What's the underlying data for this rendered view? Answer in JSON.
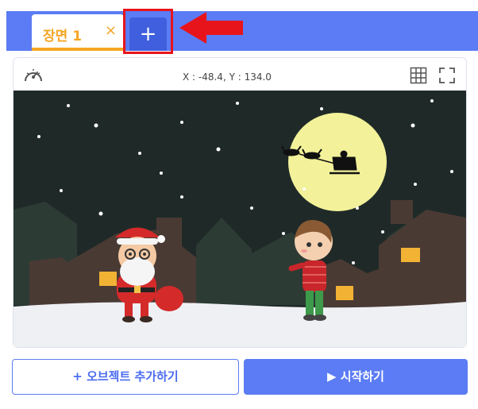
{
  "tabs": {
    "scene_tab_label": "장면 1",
    "close_glyph": "×",
    "add_scene_glyph": "+"
  },
  "toolbar": {
    "coordinates": "X : -48.4, Y : 134.0",
    "speed_icon": "gauge-icon",
    "grid_icon": "grid-icon",
    "fullscreen_icon": "fullscreen-icon"
  },
  "stage": {
    "scene": "night-christmas-village",
    "objects": [
      "santa",
      "boy",
      "moon",
      "sleigh-silhouette",
      "houses",
      "snow"
    ]
  },
  "buttons": {
    "add_object_label": "+ 오브젝트 추가하기",
    "start_label": "▶ 시작하기"
  },
  "colors": {
    "accent": "#5b7cf4",
    "tab_accent": "#f5a623",
    "highlight": "#e8141c",
    "sky": "#1f2a28",
    "moon": "#f3f29a"
  }
}
